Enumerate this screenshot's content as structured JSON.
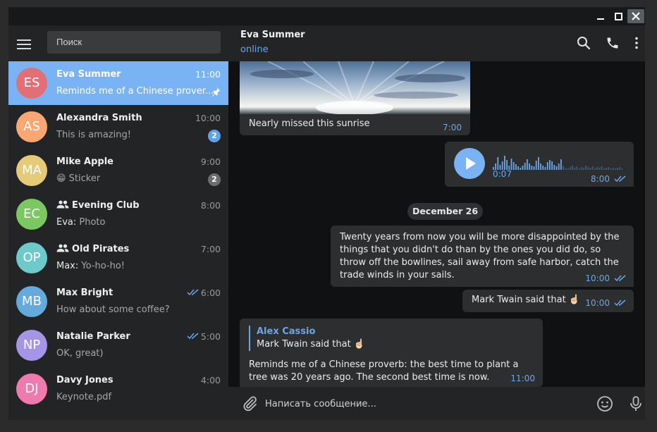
{
  "sidebar": {
    "search_placeholder": "Поиск",
    "chats": [
      {
        "initials": "ES",
        "name": "Eva Summer",
        "time": "11:00",
        "preview": "Reminds me of a Chinese prover...",
        "sender": "",
        "avatar_color": "#e17076",
        "pinned": true,
        "active": true,
        "is_group": false,
        "badge": "",
        "read_ticks": false
      },
      {
        "initials": "AS",
        "name": "Alexandra Smith",
        "time": "10:00",
        "preview": "This is amazing!",
        "sender": "",
        "avatar_color": "#faa774",
        "pinned": false,
        "active": false,
        "is_group": false,
        "badge": "2",
        "badge_style": "blue",
        "read_ticks": false
      },
      {
        "initials": "MA",
        "name": "Mike Apple",
        "time": "9:00",
        "preview": "😁 Sticker",
        "sender": "",
        "avatar_color": "#e5ca77",
        "pinned": false,
        "active": false,
        "is_group": false,
        "badge": "2",
        "badge_style": "grey",
        "read_ticks": false
      },
      {
        "initials": "EC",
        "name": "Evening Club",
        "time": "8:00",
        "preview": "Photo",
        "sender": "Eva: ",
        "avatar_color": "#7bc862",
        "pinned": false,
        "active": false,
        "is_group": true,
        "badge": "",
        "read_ticks": false
      },
      {
        "initials": "OP",
        "name": "Old Pirates",
        "time": "7:00",
        "preview": "Yo-ho-ho!",
        "sender": "Max: ",
        "avatar_color": "#6ec9cb",
        "pinned": false,
        "active": false,
        "is_group": true,
        "badge": "",
        "read_ticks": false
      },
      {
        "initials": "MB",
        "name": "Max Bright",
        "time": "6:00",
        "preview": "How about some coffee?",
        "sender": "",
        "avatar_color": "#65aadd",
        "pinned": false,
        "active": false,
        "is_group": false,
        "badge": "",
        "read_ticks": true
      },
      {
        "initials": "NP",
        "name": "Natalie Parker",
        "time": "5:00",
        "preview": "OK, great)",
        "sender": "",
        "avatar_color": "#a695e7",
        "pinned": false,
        "active": false,
        "is_group": false,
        "badge": "",
        "read_ticks": true
      },
      {
        "initials": "DJ",
        "name": "Davy Jones",
        "time": "4:00",
        "preview": "Keynote.pdf",
        "sender": "",
        "avatar_color": "#ee7aae",
        "pinned": false,
        "active": false,
        "is_group": false,
        "badge": "",
        "read_ticks": false
      }
    ]
  },
  "header": {
    "peer_name": "Eva Summer",
    "peer_status": "online"
  },
  "messages": {
    "photo": {
      "caption": "Nearly missed this sunrise",
      "time": "7:00"
    },
    "voice": {
      "duration": "0:07",
      "time": "8:00"
    },
    "date_separator": "December 26",
    "quote": {
      "text": "Twenty years from now you will be more disappointed by the things that you didn't do than by the ones you did do, so throw off the bowlines, sail away from safe harbor, catch the trade winds in your sails.",
      "time": "10:00"
    },
    "twain": {
      "text": "Mark Twain said that ☝🏻",
      "time": "10:00"
    },
    "reply": {
      "author": "Alex Cassio",
      "quoted": "Mark Twain said that ☝🏻",
      "text": "Reminds me of a Chinese proverb: the best time to plant a tree was 20 years ago. The second best time is now.",
      "time": "11:00"
    }
  },
  "compose": {
    "placeholder": "Написать сообщение..."
  },
  "colors": {
    "accent": "#7ab3f3",
    "link": "#6ba6e8",
    "sidebar_bg": "#232426",
    "chat_bg": "#101112",
    "bubble_bg": "#2d2e30"
  },
  "icons": [
    "hamburger-menu-icon",
    "search-icon",
    "phone-icon",
    "more-vertical-icon",
    "pin-icon",
    "group-icon",
    "double-check-icon",
    "play-icon",
    "attach-icon",
    "emoji-icon",
    "microphone-icon",
    "minimize-icon",
    "maximize-icon",
    "close-icon"
  ]
}
